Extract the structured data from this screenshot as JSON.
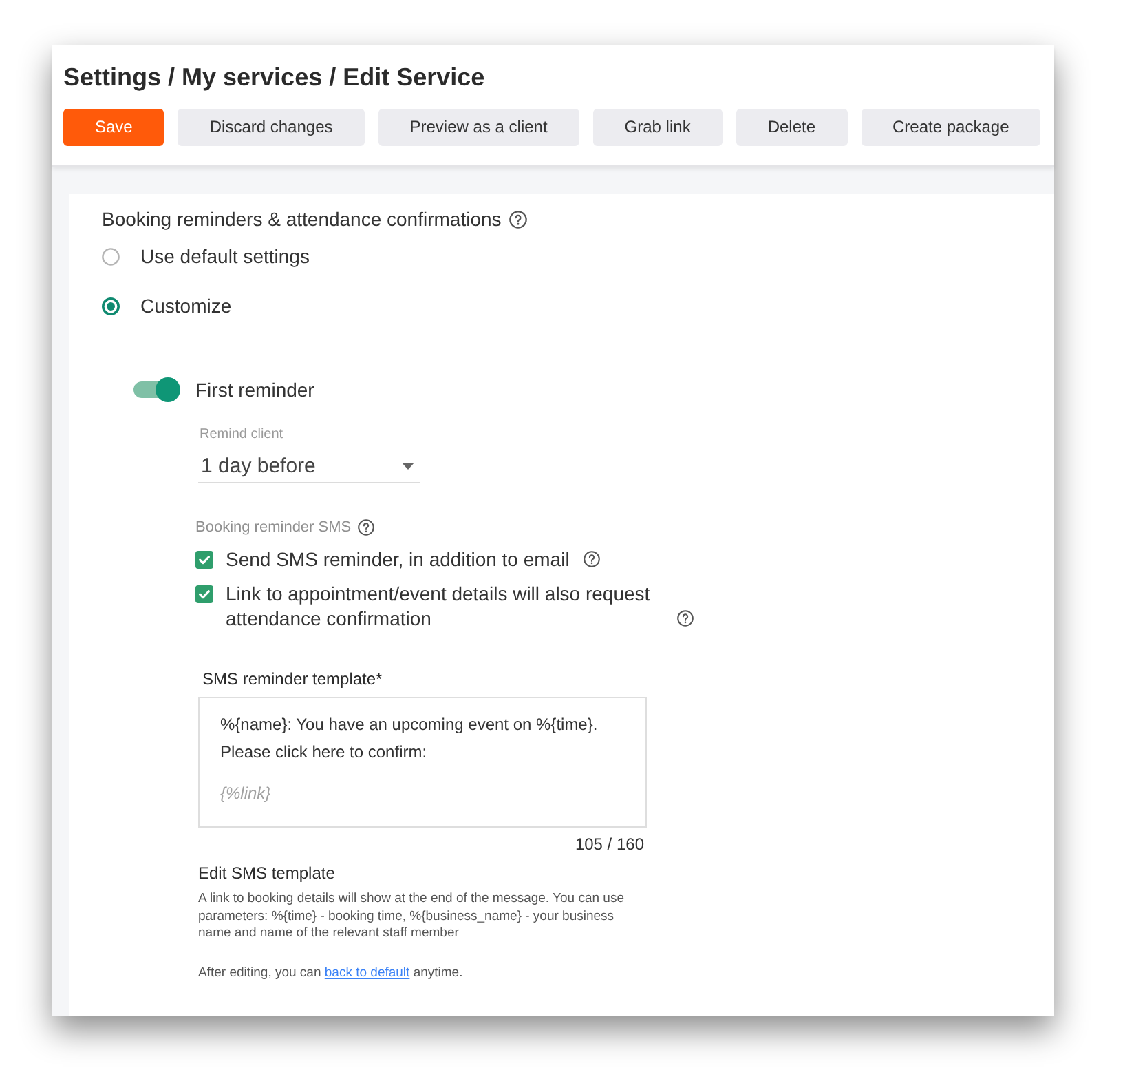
{
  "page": {
    "breadcrumb": "Settings / My services / Edit Service"
  },
  "toolbar": {
    "buttons": [
      {
        "label": "Save",
        "kind": "primary"
      },
      {
        "label": "Discard changes",
        "kind": "secondary"
      },
      {
        "label": "Preview as a client",
        "kind": "secondary"
      },
      {
        "label": "Grab link",
        "kind": "secondary"
      },
      {
        "label": "Delete",
        "kind": "secondary"
      },
      {
        "label": "Create package",
        "kind": "secondary"
      }
    ]
  },
  "reminders": {
    "title": "Booking reminders & attendance confirmations",
    "options": [
      {
        "label": "Use default settings",
        "selected": false
      },
      {
        "label": "Customize",
        "selected": true
      }
    ]
  },
  "first_reminder": {
    "label": "First reminder",
    "on": true,
    "remind_client": {
      "label": "Remind client",
      "value": "1 day before"
    },
    "sms": {
      "title": "Booking reminder SMS",
      "options": [
        {
          "label": "Send SMS reminder, in addition to email",
          "checked": true
        },
        {
          "label": "Link to appointment/event details will also request attendance confirmation",
          "checked": true
        }
      ]
    },
    "template": {
      "label": "SMS reminder template*",
      "lines": [
        "%{name}: You have an upcoming event on %{time}.",
        "Please click here to confirm:"
      ],
      "link_token": "{%link}",
      "counter": "105 / 160"
    },
    "help": {
      "title": "Edit SMS template",
      "text": "A link to booking details will show at the end of the message. You can use parameters: %{time} - booking time, %{business_name} - your business name and name of the relevant staff member",
      "reset_before": "After editing, you can",
      "reset_link": "back to default",
      "reset_after": "anytime."
    }
  }
}
